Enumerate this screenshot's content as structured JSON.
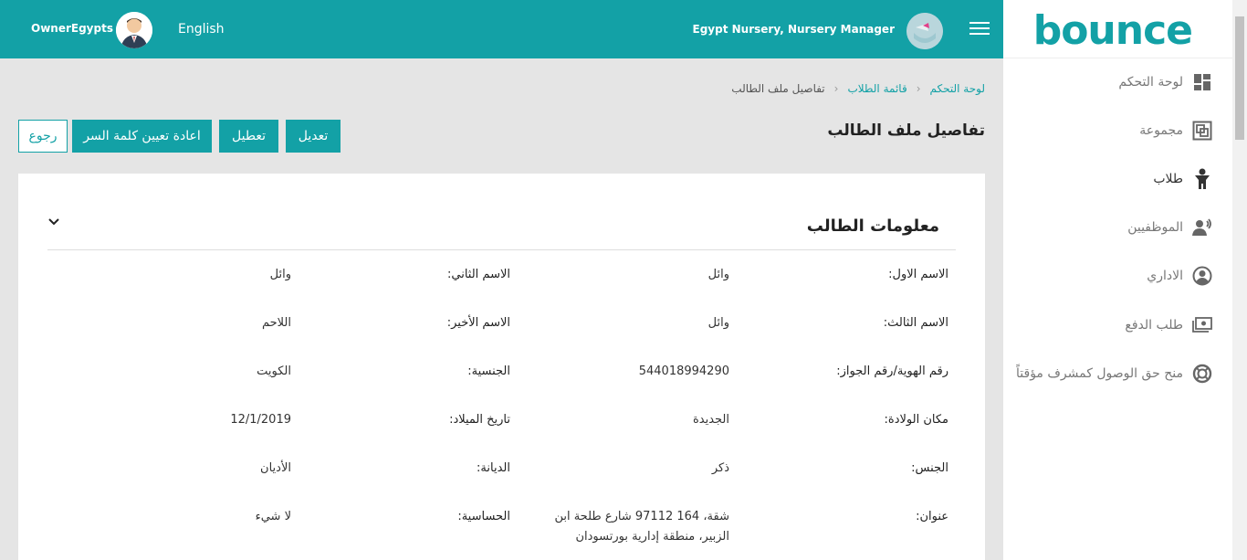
{
  "header": {
    "owner_name": "OwnerEgypts",
    "language": "English",
    "manager": "Egypt Nursery, Nursery Manager"
  },
  "sidebar": {
    "logo_text": "bounce",
    "items": [
      {
        "label": "لوحة التحكم",
        "icon": "dashboard-icon"
      },
      {
        "label": "مجموعة",
        "icon": "group-icon"
      },
      {
        "label": "طلاب",
        "icon": "student-icon"
      },
      {
        "label": "الموظفيين",
        "icon": "staff-icon"
      },
      {
        "label": "الاداري",
        "icon": "admin-icon"
      },
      {
        "label": "طلب الدفع",
        "icon": "payment-icon"
      },
      {
        "label": "منح حق الوصول كمشرف مؤقتاً",
        "icon": "lifebuoy-icon"
      }
    ]
  },
  "breadcrumb": {
    "home": "لوحة التحكم",
    "list": "قائمة الطلاب",
    "current": "تفاصيل ملف الطالب"
  },
  "page": {
    "title": "تفاصيل ملف الطالب",
    "buttons": {
      "edit": "تعديل",
      "disable": "تعطيل",
      "reset_password": "اعادة تعيين كلمة السر",
      "back": "رجوع"
    }
  },
  "card": {
    "title": "معلومات الطالب",
    "rows": [
      [
        {
          "label": "الاسم الاول:",
          "value": "وائل"
        },
        {
          "label": "الاسم الثاني:",
          "value": "وائل"
        }
      ],
      [
        {
          "label": "الاسم الثالث:",
          "value": "وائل"
        },
        {
          "label": "الاسم الأخير:",
          "value": "اللاحم"
        }
      ],
      [
        {
          "label": "رقم الهوية/رقم الجواز:",
          "value": "544018994290"
        },
        {
          "label": "الجنسية:",
          "value": "الكويت"
        }
      ],
      [
        {
          "label": "مكان الولادة:",
          "value": "الجديدة"
        },
        {
          "label": "تاريخ الميلاد:",
          "value": "12/1/2019"
        }
      ],
      [
        {
          "label": "الجنس:",
          "value": "ذكر"
        },
        {
          "label": "الديانة:",
          "value": "الأديان"
        }
      ],
      [
        {
          "label": "عنوان:",
          "value": "شقة، 164 97112 شارع طلحة ابن الزبير، منطقة إدارية بورتسودان"
        },
        {
          "label": "الحساسية:",
          "value": "لا شيء"
        }
      ]
    ]
  },
  "colors": {
    "primary": "#13a1a6",
    "logo_accent": "#8cc63f"
  }
}
